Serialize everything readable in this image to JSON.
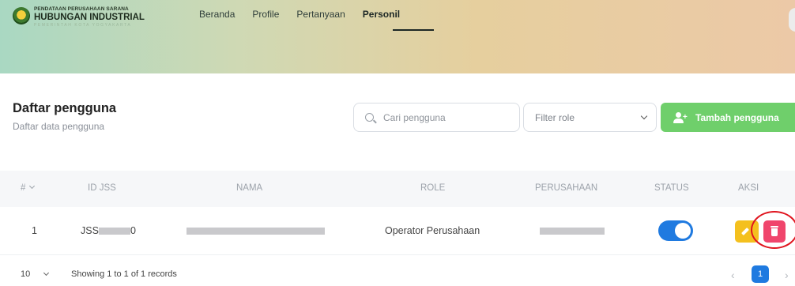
{
  "brand": {
    "line1": "PENDATAAN PERUSAHAAN SARANA",
    "line2": "HUBUNGAN INDUSTRIAL",
    "tagline": "PEMERINTAH KOTA YOGYAKARTA"
  },
  "nav": {
    "items": [
      {
        "label": "Beranda",
        "active": false
      },
      {
        "label": "Profile",
        "active": false
      },
      {
        "label": "Pertanyaan",
        "active": false
      },
      {
        "label": "Personil",
        "active": true
      }
    ]
  },
  "page": {
    "title": "Daftar pengguna",
    "subtitle": "Daftar data pengguna"
  },
  "controls": {
    "search_placeholder": "Cari pengguna",
    "filter_label": "Filter role",
    "add_button": "Tambah pengguna"
  },
  "table": {
    "headers": [
      "#",
      "ID JSS",
      "NAMA",
      "ROLE",
      "PERUSAHAAN",
      "STATUS",
      "AKSI"
    ],
    "rows": [
      {
        "num": "1",
        "id_prefix": "JSS",
        "id_suffix": "0",
        "role": "Operator Perusahaan",
        "status_active": true
      }
    ]
  },
  "footer": {
    "page_size": "10",
    "records_info": "Showing 1 to 1 of 1 records",
    "current_page": "1",
    "prev_icon": "‹",
    "next_icon": "›"
  },
  "colors": {
    "primary": "#1f7ae0",
    "add_button": "#6fcf6b",
    "edit": "#f4c01e",
    "delete": "#f0456c",
    "highlight": "#e0141e"
  }
}
